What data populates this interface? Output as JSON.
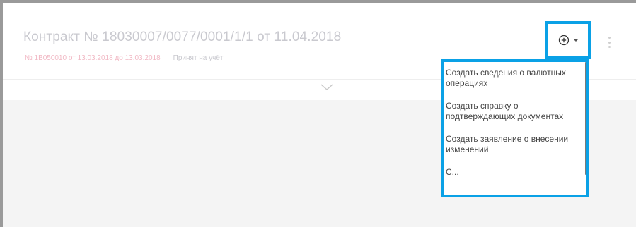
{
  "contract": {
    "title": "Контракт № 18030007/0077/0001/1/1 от 11.04.2018",
    "document_ref": "№ 1B050010 от 13.03.2018 до 13.03.2018",
    "status": "Принят на учёт"
  },
  "actions": {
    "add_icon": "plus-circle-icon",
    "caret_icon": "caret-down-icon",
    "more_icon": "kebab-vertical-icon"
  },
  "dropdown": {
    "items": [
      {
        "label": "Создать сведения о валютных операциях"
      },
      {
        "label": "Создать справку о подтверждающих документах"
      },
      {
        "label": "Создать заявление о внесении изменений"
      },
      {
        "label": "С..."
      }
    ]
  },
  "colors": {
    "highlight": "#0aa1e6",
    "title": "#c9c9cf",
    "document_ref": "#f1b8c4",
    "content_background": "#f4f4f4"
  }
}
